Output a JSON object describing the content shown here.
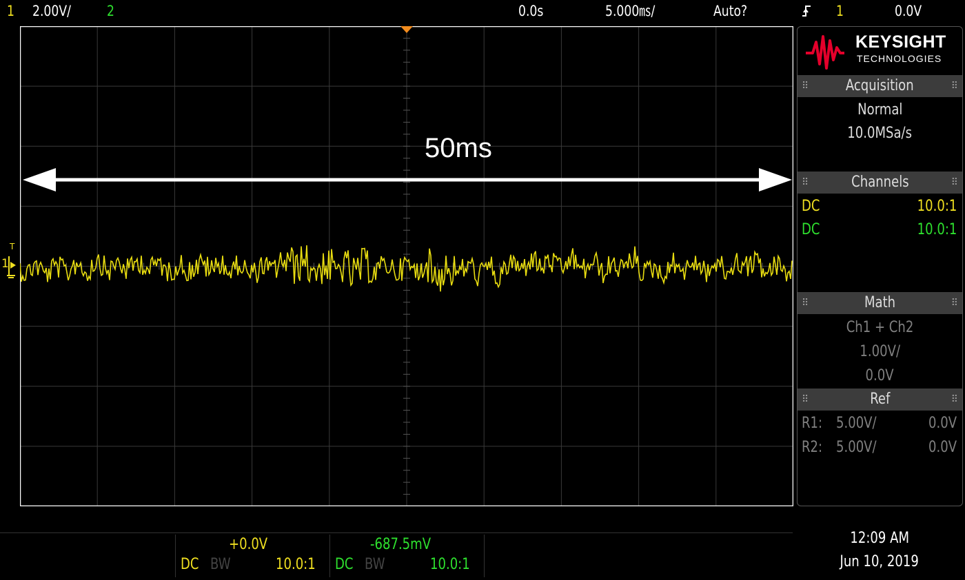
{
  "status_bar": {
    "ch1_label": "1",
    "ch1_scale": "2.00V/",
    "ch2_label": "2",
    "time_delay": "0.0s",
    "time_scale": "5.000㎳/",
    "trigger_mode": "Auto?",
    "trigger_icon": "rising-edge-icon",
    "trigger_source": "1",
    "trigger_level": "0.0V"
  },
  "annotation": {
    "text": "50ms"
  },
  "waveform": {
    "channel": "1",
    "color": "#e8dc10",
    "trigger_marker": "T",
    "ground_marker": "ground-icon"
  },
  "panel": {
    "brand_name": "KEYSIGHT",
    "brand_sub": "TECHNOLOGIES",
    "brand_color": "#e4002b",
    "acquisition": {
      "title": "Acquisition",
      "mode": "Normal",
      "rate": "10.0MSa/s"
    },
    "channels": {
      "title": "Channels",
      "rows": [
        {
          "coupling": "DC",
          "probe": "10.0:1",
          "color": "#f0e020"
        },
        {
          "coupling": "DC",
          "probe": "10.0:1",
          "color": "#2ee02e"
        }
      ]
    },
    "math": {
      "title": "Math",
      "func": "Ch1 + Ch2",
      "scale": "1.00V/",
      "offset": "0.0V"
    },
    "ref": {
      "title": "Ref",
      "rows": [
        {
          "label": "R1:",
          "scale": "5.00V/",
          "offset": "0.0V"
        },
        {
          "label": "R2:",
          "scale": "5.00V/",
          "offset": "0.0V"
        }
      ]
    }
  },
  "bottom": {
    "ch1": {
      "offset": "+0.0V",
      "coupling": "DC",
      "bw": "BW",
      "probe": "10.0:1"
    },
    "ch2": {
      "offset": "-687.5mV",
      "coupling": "DC",
      "bw": "BW",
      "probe": "10.0:1"
    },
    "time": "12:09 AM",
    "date": "Jun 10, 2019"
  }
}
